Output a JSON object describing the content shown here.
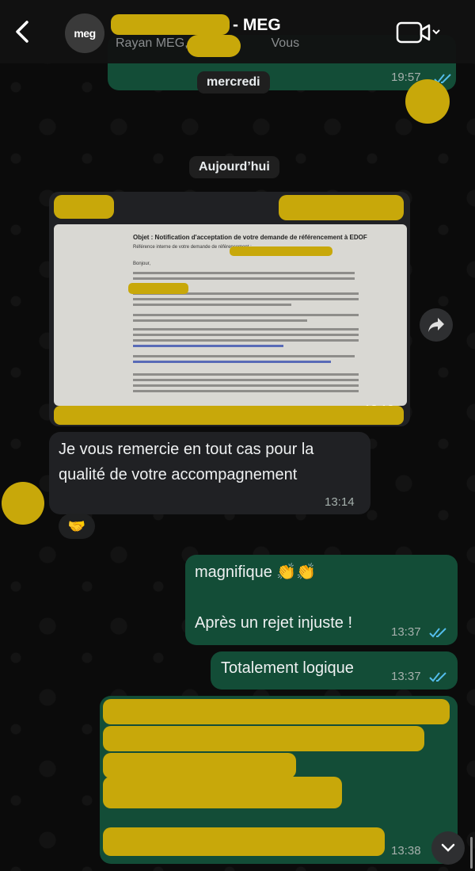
{
  "header": {
    "title": "- MEG",
    "subtitle_prefix": "Rayan MEG,",
    "subtitle_suffix": "Vous",
    "avatar_text": "meg"
  },
  "dates": {
    "first": "mercredi",
    "second": "Aujourd’hui"
  },
  "messages": {
    "top_time": "19:57",
    "image_time": "13:12",
    "doc": {
      "heading": "Objet : Notification d'acceptation de votre demande de référencement à EDOF",
      "ref": "Référence interne de votre demande de référencement :",
      "greeting": "Bonjour,"
    },
    "thanks_text": "Je vous remercie en tout cas pour la qualité de votre accompagnement",
    "thanks_time": "13:14",
    "reaction": "🤝",
    "magnifique_text": "magnifique 👏👏",
    "rejet_text": "Après un rejet injuste !",
    "rejet_time": "13:37",
    "logique_text": "Totalement logique",
    "logique_time": "13:37",
    "last_time": "13:38"
  },
  "colors": {
    "outgoing": "#134d37",
    "incoming": "#202124",
    "redaction": "#c8a80a",
    "read_ticks": "#53bdeb"
  },
  "icons": {
    "back": "chevron-left-icon",
    "video": "video-camera-icon",
    "forward": "forward-icon",
    "scroll": "chevron-down-icon"
  }
}
